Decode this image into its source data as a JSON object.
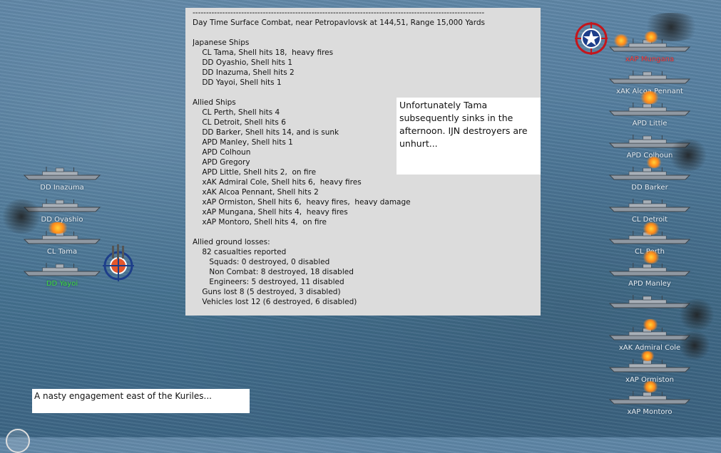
{
  "report": {
    "lines": [
      "------------------------------------------------------------------------------------------------------------",
      "Day Time Surface Combat, near Petropavlovsk at 144,51, Range 15,000 Yards",
      "",
      "Japanese Ships",
      "    CL Tama, Shell hits 18,  heavy fires",
      "    DD Oyashio, Shell hits 1",
      "    DD Inazuma, Shell hits 2",
      "    DD Yayoi, Shell hits 1",
      "",
      "Allied Ships",
      "    CL Perth, Shell hits 4",
      "    CL Detroit, Shell hits 6",
      "    DD Barker, Shell hits 14, and is sunk",
      "    APD Manley, Shell hits 1",
      "    APD Colhoun",
      "    APD Gregory",
      "    APD Little, Shell hits 2,  on fire",
      "    xAK Admiral Cole, Shell hits 6,  heavy fires",
      "    xAK Alcoa Pennant, Shell hits 2",
      "    xAP Ormiston, Shell hits 6,  heavy fires,  heavy damage",
      "    xAP Mungana, Shell hits 4,  heavy fires",
      "    xAP Montoro, Shell hits 4,  on fire",
      "",
      "Allied ground losses:",
      "    82 casualties reported",
      "       Squads: 0 destroyed, 0 disabled",
      "       Non Combat: 8 destroyed, 18 disabled",
      "       Engineers: 5 destroyed, 11 disabled",
      "    Guns lost 8 (5 destroyed, 3 disabled)",
      "    Vehicles lost 12 (6 destroyed, 6 disabled)"
    ]
  },
  "note": "Unfortunately Tama subsequently sinks in the afternoon.  IJN destroyers are unhurt...",
  "caption": "A nasty engagement east of the Kuriles...",
  "japanese_ships": [
    {
      "name": "DD Inazuma",
      "color": "#e8eef3"
    },
    {
      "name": "DD Oyashio",
      "color": "#e8eef3"
    },
    {
      "name": "CL Tama",
      "color": "#e8eef3"
    },
    {
      "name": "DD Yayoi",
      "color": "#3fdc3f"
    }
  ],
  "allied_ships": [
    {
      "name": "xAP Mungana",
      "color": "#ff3b3b"
    },
    {
      "name": "xAK Alcoa Pennant",
      "color": "#e8eef3"
    },
    {
      "name": "APD Little",
      "color": "#e8eef3"
    },
    {
      "name": "APD Colhoun",
      "color": "#e8eef3"
    },
    {
      "name": "DD Barker",
      "color": "#e8eef3"
    },
    {
      "name": "CL Detroit",
      "color": "#e8eef3"
    },
    {
      "name": "CL Perth",
      "color": "#e8eef3"
    },
    {
      "name": "APD Manley",
      "color": "#e8eef3"
    },
    {
      "name": "",
      "color": "#e8eef3"
    },
    {
      "name": "xAK Admiral Cole",
      "color": "#e8eef3"
    },
    {
      "name": "xAP Ormiston",
      "color": "#e8eef3"
    },
    {
      "name": "xAP Montoro",
      "color": "#e8eef3"
    }
  ],
  "icons": {
    "allied_target": "us-star-roundel-icon",
    "japanese_target": "ijn-target-icon"
  }
}
